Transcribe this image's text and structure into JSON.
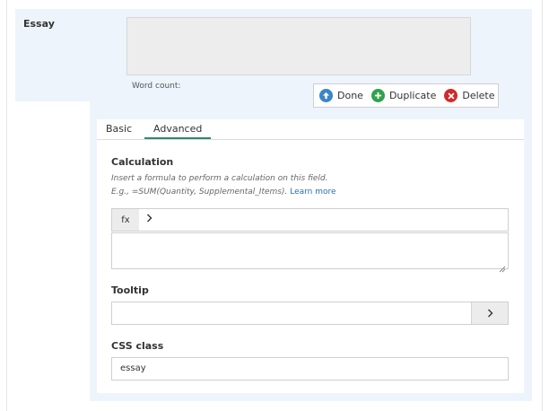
{
  "field": {
    "label": "Essay",
    "word_count_label": "Word count:"
  },
  "actions": {
    "done": {
      "label": "Done",
      "icon": "arrow-up-icon",
      "color": "#3a86c8"
    },
    "duplicate": {
      "label": "Duplicate",
      "icon": "plus-icon",
      "color": "#2fa14c"
    },
    "delete": {
      "label": "Delete",
      "icon": "x-icon",
      "color": "#d02a2a"
    }
  },
  "tabs": [
    {
      "label": "Basic",
      "active": false
    },
    {
      "label": "Advanced",
      "active": true
    }
  ],
  "tab_accent_color": "#2a8a6e",
  "calculation": {
    "label": "Calculation",
    "help_line1": "Insert a formula to perform a calculation on this field.",
    "help_line2": "E.g., =SUM(Quantity, Supplemental_Items).",
    "learn_more": "Learn more",
    "fx_label": "fx",
    "formula_value": ""
  },
  "tooltip": {
    "label": "Tooltip",
    "value": ""
  },
  "css_class": {
    "label": "CSS class",
    "value": "essay"
  }
}
